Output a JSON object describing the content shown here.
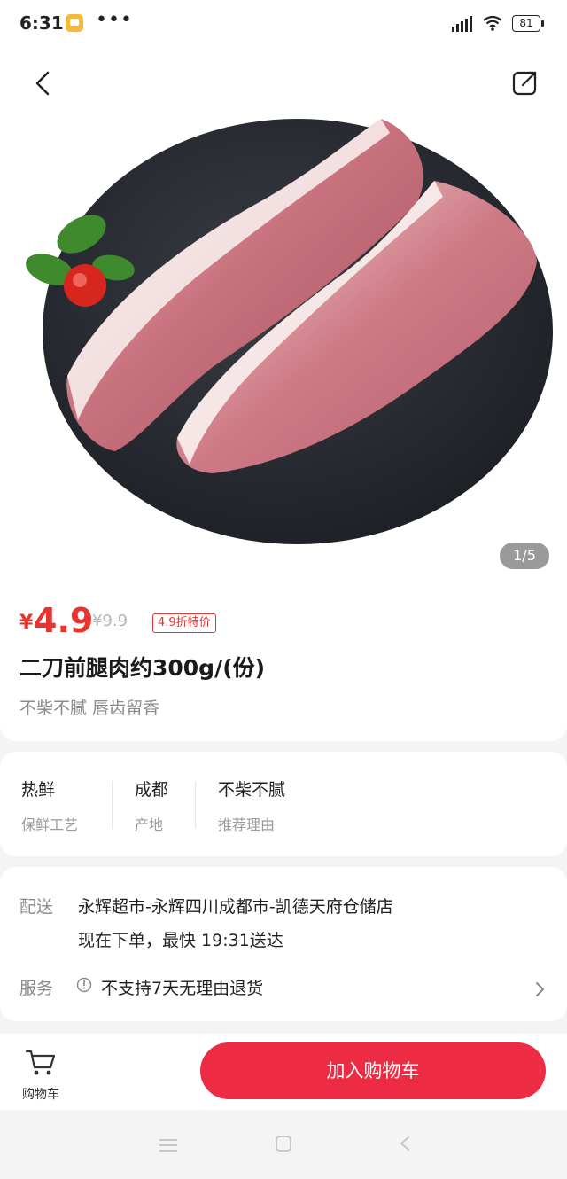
{
  "status_bar": {
    "time": "6:31",
    "more": "•••",
    "battery": "81"
  },
  "gallery": {
    "indicator": "1/5"
  },
  "product": {
    "price_symbol": "¥",
    "price": "4.9",
    "original_price": "¥9.9",
    "discount_badge": "4.9折特价",
    "title": "二刀前腿肉约300g/(份)",
    "subtitle": "不柴不腻 唇齿留香"
  },
  "features": [
    {
      "value": "热鲜",
      "label": "保鲜工艺"
    },
    {
      "value": "成都",
      "label": "产地"
    },
    {
      "value": "不柴不腻",
      "label": "推荐理由"
    }
  ],
  "delivery": {
    "label": "配送",
    "store": "永辉超市-永辉四川成都市-凯德天府仓储店",
    "eta": "现在下单，最快 19:31送达"
  },
  "service": {
    "label": "服务",
    "text": "不支持7天无理由退货"
  },
  "bottom_bar": {
    "cart_label": "购物车",
    "add_to_cart": "加入购物车"
  },
  "colors": {
    "accent": "#e8332f",
    "button": "#ee2b44"
  }
}
